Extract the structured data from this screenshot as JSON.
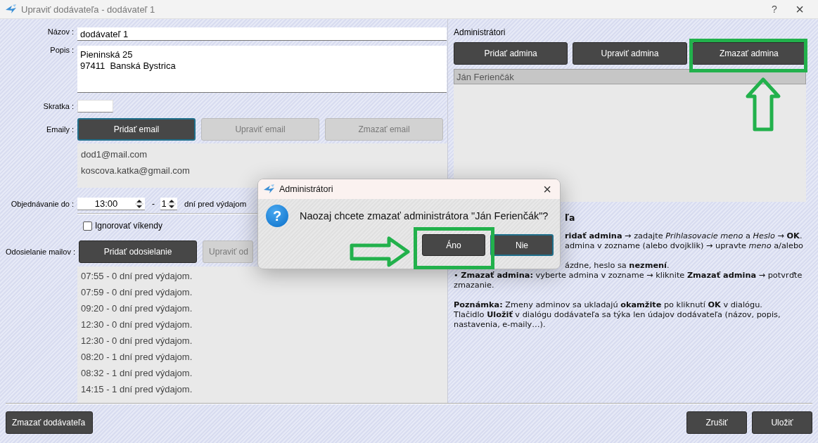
{
  "window": {
    "title": "Upraviť dodávateľa - dodávateľ 1",
    "help": "?",
    "close": "×"
  },
  "supplier": {
    "name": {
      "label": "Názov :",
      "value": "dodávateľ 1"
    },
    "description": {
      "label": "Popis :",
      "value": "Pieninská 25\n97411  Banská Bystrica"
    },
    "short_name": {
      "label": "Skratka :"
    },
    "emails": {
      "label": "Emaily :",
      "buttons": [
        {
          "label": "Pridať email",
          "disabled": false,
          "focused": true
        },
        {
          "label": "Upraviť email",
          "disabled": true,
          "focused": false
        },
        {
          "label": "Zmazať email",
          "disabled": true,
          "focused": false
        }
      ],
      "items": [
        "dod1@mail.com",
        "koscova.katka@gmail.com"
      ]
    },
    "ordering": {
      "label": "Objednávanie do :",
      "time": "13:00",
      "separator": "-",
      "days": "1",
      "suffix": "dní pred výdajom"
    },
    "ignore_weekends": {
      "label": "Ignorovať víkendy",
      "checked": false
    },
    "mail_sending": {
      "label": "Odosielanie mailov :",
      "buttons": [
        {
          "label": "Pridať odosielanie",
          "disabled": false,
          "focused": false
        },
        {
          "label": "Upraviť od",
          "disabled": true,
          "focused": false
        }
      ],
      "items": [
        "07:55 - 0 dní pred výdajom.",
        "07:59 - 0 dní pred výdajom.",
        "09:20 - 0 dní pred výdajom.",
        "12:30 - 0 dní pred výdajom.",
        "12:30 - 0 dní pred výdajom.",
        "08:20 - 1 dní pred výdajom.",
        "08:32 - 1 dní pred výdajom.",
        "14:15 - 1 dní pred výdajom."
      ]
    }
  },
  "admins": {
    "title": "Administrátori",
    "buttons": [
      {
        "label": "Pridať admina",
        "disabled": false,
        "focused": false
      },
      {
        "label": "Upraviť admina",
        "disabled": false,
        "focused": false
      },
      {
        "label": "Zmazať admina",
        "disabled": false,
        "focused": false
      }
    ],
    "items": [
      {
        "name": "Ján Ferienčák",
        "selected": true
      }
    ],
    "help": [
      {
        "kind": "heading",
        "text": "ľa"
      },
      {
        "kind": "fragment",
        "text": "**ridať admina** → zadajte *Prihlasovacie meno* a *Heslo* → **OK**."
      },
      {
        "kind": "fragment",
        "text": "admina v zozname (alebo dvojklik) → upravte *meno* a/alebo"
      },
      {
        "kind": "tail",
        "text": "ázdne, heslo sa **nezmení**."
      },
      {
        "kind": "bullet",
        "text": "• **Zmazať admina:** vyberte admina v zozname → kliknite **Zmazať admina** → potvrďte zmazanie."
      },
      {
        "kind": "note",
        "text": "**Poznámka:** Zmeny adminov sa ukladajú **okamžite** po kliknutí **OK** v dialógu."
      },
      {
        "kind": "text",
        "text": "Tlačidlo **Uložiť** v dialógu dodávateľa sa týka len údajov dodávateľa (názov, popis, nastavenia, e-maily…)."
      }
    ]
  },
  "footer": {
    "buttons": [
      {
        "label": "Zmazať dodávateľa",
        "kind": "left"
      },
      {
        "label": "Zrušiť",
        "kind": "right"
      },
      {
        "label": "Uložiť",
        "kind": "right"
      }
    ]
  },
  "dialog": {
    "title": "Administrátori",
    "close": "×",
    "icon": "?",
    "message": "Naozaj chcete zmazať administrátora \"Ján Ferienčák\"?",
    "buttons": [
      {
        "label": "Áno",
        "focused": false
      },
      {
        "label": "Nie",
        "focused": true
      }
    ]
  }
}
